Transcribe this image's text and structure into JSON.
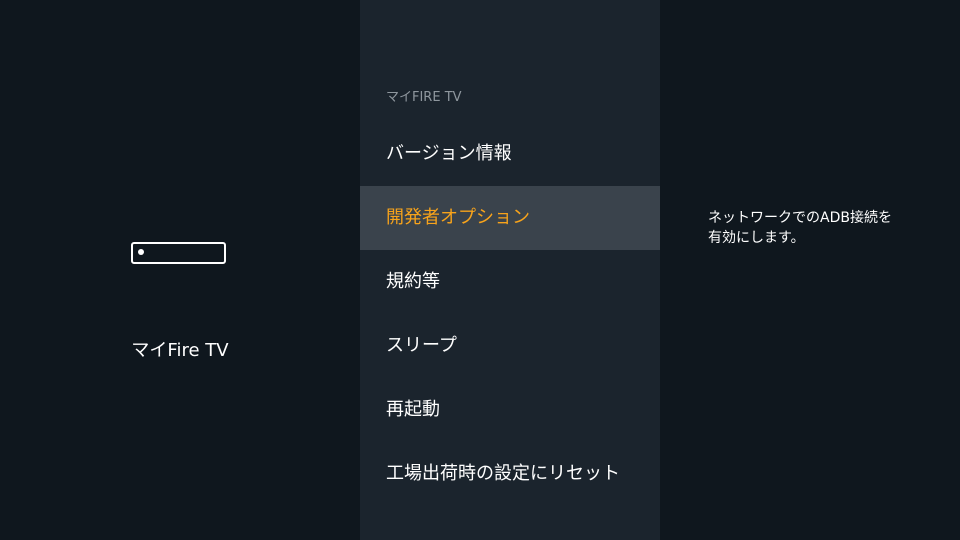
{
  "left_panel": {
    "device_icon": "fire-tv-stick-icon",
    "device_label": "マイFire TV"
  },
  "menu": {
    "header": "マイFIRE TV",
    "items": [
      {
        "label": "バージョン情報",
        "focused": false
      },
      {
        "label": "開発者オプション",
        "focused": true
      },
      {
        "label": "規約等",
        "focused": false
      },
      {
        "label": "スリープ",
        "focused": false
      },
      {
        "label": "再起動",
        "focused": false
      },
      {
        "label": "工場出荷時の設定にリセット",
        "focused": false
      }
    ]
  },
  "detail": {
    "description_line1": "ネットワークでのADB接続を",
    "description_line2": "有効にします。"
  },
  "colors": {
    "background": "#0f171e",
    "menu_background": "#1b242d",
    "focus_background": "#3a434c",
    "accent": "#f7a31b",
    "header_text": "#8f979e"
  }
}
